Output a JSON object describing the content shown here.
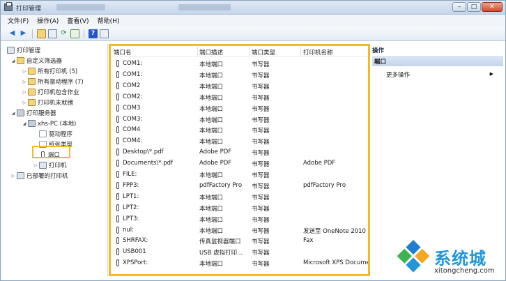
{
  "window": {
    "title": "打印管理"
  },
  "menu": [
    "文件(F)",
    "操作(A)",
    "查看(V)",
    "帮助(H)"
  ],
  "toolbar": {
    "icons": [
      "back-arrow-icon",
      "forward-arrow-icon",
      "up-folder-icon",
      "show-hide-tree-icon",
      "refresh-icon",
      "export-icon",
      "help-icon",
      "properties-icon"
    ]
  },
  "tree": {
    "root": "打印管理",
    "custom_filters": "自定义筛选器",
    "all_printers": "所有打印机 (5)",
    "all_drivers": "所有驱动程序 (7)",
    "printers_with_jobs": "打印机包含作业",
    "printers_not_ready": "打印机未就绪",
    "print_servers": "打印服务器",
    "server": "xhs-PC (本地)",
    "drivers": "驱动程序",
    "forms": "纸张类型",
    "ports": "端口",
    "printers": "打印机",
    "deployed_printers": "已部署的打印机"
  },
  "list": {
    "columns": [
      "端口名",
      "端口描述",
      "端口类型",
      "打印机名称"
    ],
    "rows": [
      {
        "name": "COM1:",
        "desc": "本地端口",
        "type": "书写器",
        "printer": ""
      },
      {
        "name": "COM1:",
        "desc": "本地端口",
        "type": "书写器",
        "printer": ""
      },
      {
        "name": "COM2",
        "desc": "本地端口",
        "type": "书写器",
        "printer": ""
      },
      {
        "name": "COM2:",
        "desc": "本地端口",
        "type": "书写器",
        "printer": ""
      },
      {
        "name": "COM3",
        "desc": "本地端口",
        "type": "书写器",
        "printer": ""
      },
      {
        "name": "COM3:",
        "desc": "本地端口",
        "type": "书写器",
        "printer": ""
      },
      {
        "name": "COM4",
        "desc": "本地端口",
        "type": "书写器",
        "printer": ""
      },
      {
        "name": "COM4:",
        "desc": "本地端口",
        "type": "书写器",
        "printer": ""
      },
      {
        "name": "Desktop\\*.pdf",
        "desc": "Adobe PDF",
        "type": "书写器",
        "printer": ""
      },
      {
        "name": "Documents\\*.pdf",
        "desc": "Adobe PDF",
        "type": "书写器",
        "printer": "Adobe PDF"
      },
      {
        "name": "FILE:",
        "desc": "本地端口",
        "type": "书写器",
        "printer": ""
      },
      {
        "name": "FPP3:",
        "desc": "pdfFactory Pro",
        "type": "书写器",
        "printer": "pdfFactory Pro"
      },
      {
        "name": "LPT1:",
        "desc": "本地端口",
        "type": "书写器",
        "printer": ""
      },
      {
        "name": "LPT2:",
        "desc": "本地端口",
        "type": "书写器",
        "printer": ""
      },
      {
        "name": "LPT3:",
        "desc": "本地端口",
        "type": "书写器",
        "printer": ""
      },
      {
        "name": "nul:",
        "desc": "本地端口",
        "type": "书写器",
        "printer": "发送至 OneNote 2010"
      },
      {
        "name": "SHRFAX:",
        "desc": "传真监视器端口",
        "type": "书写器",
        "printer": "Fax"
      },
      {
        "name": "USB001",
        "desc": "USB 虚拟打印...",
        "type": "书写器",
        "printer": ""
      },
      {
        "name": "XPSPort:",
        "desc": "本地端口",
        "type": "书写器",
        "printer": "Microsoft XPS Document Writer"
      }
    ]
  },
  "actions": {
    "title": "操作",
    "section": "端口",
    "more": "更多操作"
  },
  "watermark": {
    "text": "系统城",
    "url": "xitongcheng.com",
    "colors": [
      "#2196d8",
      "#f5a623",
      "#3fb34f",
      "#1e7fd0"
    ]
  }
}
